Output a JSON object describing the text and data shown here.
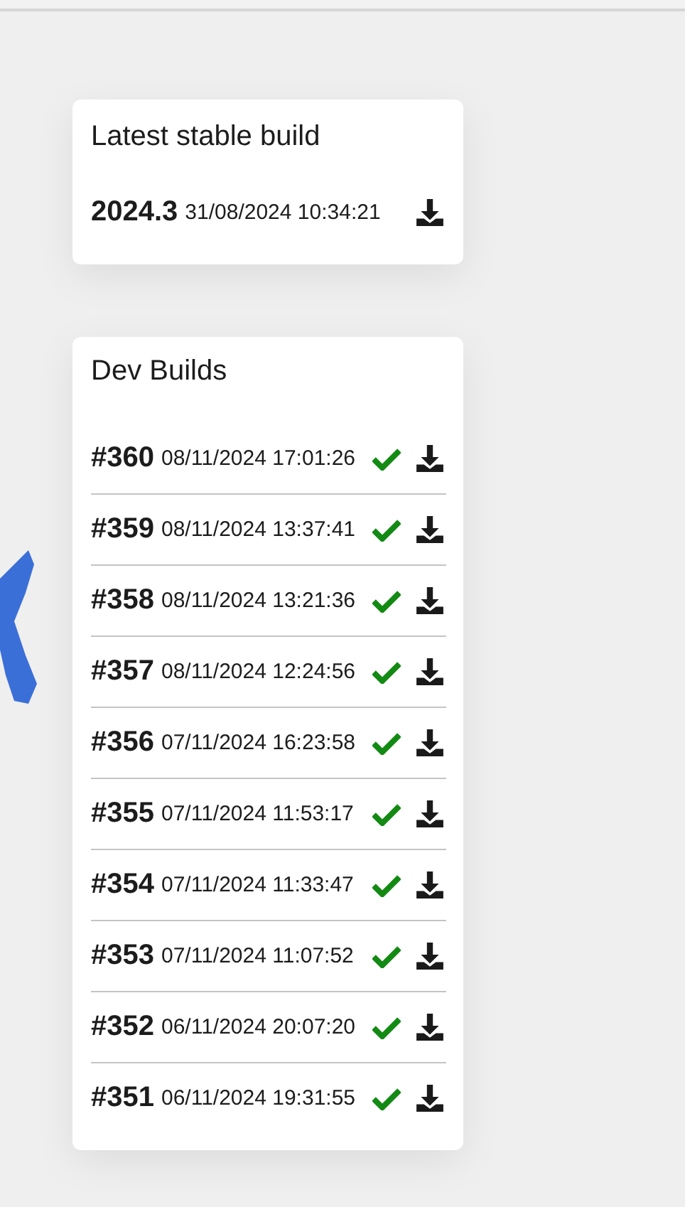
{
  "stable": {
    "title": "Latest stable build",
    "version": "2024.3",
    "date": "31/08/2024 10:34:21"
  },
  "dev": {
    "title": "Dev Builds",
    "builds": [
      {
        "number": "#360",
        "date": "08/11/2024 17:01:26",
        "passed": true
      },
      {
        "number": "#359",
        "date": "08/11/2024 13:37:41",
        "passed": true
      },
      {
        "number": "#358",
        "date": "08/11/2024 13:21:36",
        "passed": true
      },
      {
        "number": "#357",
        "date": "08/11/2024 12:24:56",
        "passed": true
      },
      {
        "number": "#356",
        "date": "07/11/2024 16:23:58",
        "passed": true
      },
      {
        "number": "#355",
        "date": "07/11/2024 11:53:17",
        "passed": true
      },
      {
        "number": "#354",
        "date": "07/11/2024 11:33:47",
        "passed": true
      },
      {
        "number": "#353",
        "date": "07/11/2024 11:07:52",
        "passed": true
      },
      {
        "number": "#352",
        "date": "06/11/2024 20:07:20",
        "passed": true
      },
      {
        "number": "#351",
        "date": "06/11/2024 19:31:55",
        "passed": true
      }
    ]
  }
}
